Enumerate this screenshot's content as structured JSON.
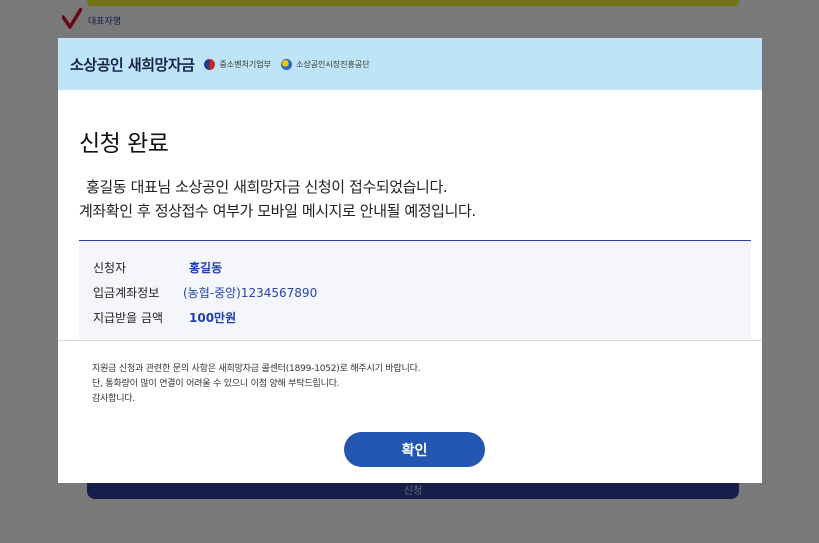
{
  "background": {
    "representative_label": "대표자명",
    "submit_label": "신청"
  },
  "header": {
    "title": "소상공인 새희망자금",
    "logos": [
      {
        "name": "gov-emblem-icon",
        "label": "중소벤처기업부"
      },
      {
        "name": "semas-logo-icon",
        "label": "소상공인시장진흥공단"
      }
    ]
  },
  "modal": {
    "title": "신청 완료",
    "message_line1": "홍길동 대표님 소상공인 새희망자금 신청이 접수되었습니다.",
    "message_line2": "계좌확인 후 정상접수 여부가 모바일 메시지로 안내될 예정입니다.",
    "info": {
      "applicant_label": "신청자",
      "applicant_value": "홍길동",
      "account_label": "입금계좌정보",
      "account_value": "(농협-중앙)1234567890",
      "amount_label": "지급받을 금액",
      "amount_value": "100만원"
    },
    "notice_line1": "지원금 신청과 관련한 문의 사항은 새희망자금 콜센터(1899-1052)로 해주시기 바랍니다.",
    "notice_line2": "단, 통화량이 많이 연결이 어려울 수 있으니 이점 양해 부탁드립니다.",
    "notice_line3": "감사합니다.",
    "confirm_label": "확인"
  },
  "colors": {
    "header_bg": "#bfe4f7",
    "primary": "#2256b0",
    "value_text": "#1b3da6"
  }
}
